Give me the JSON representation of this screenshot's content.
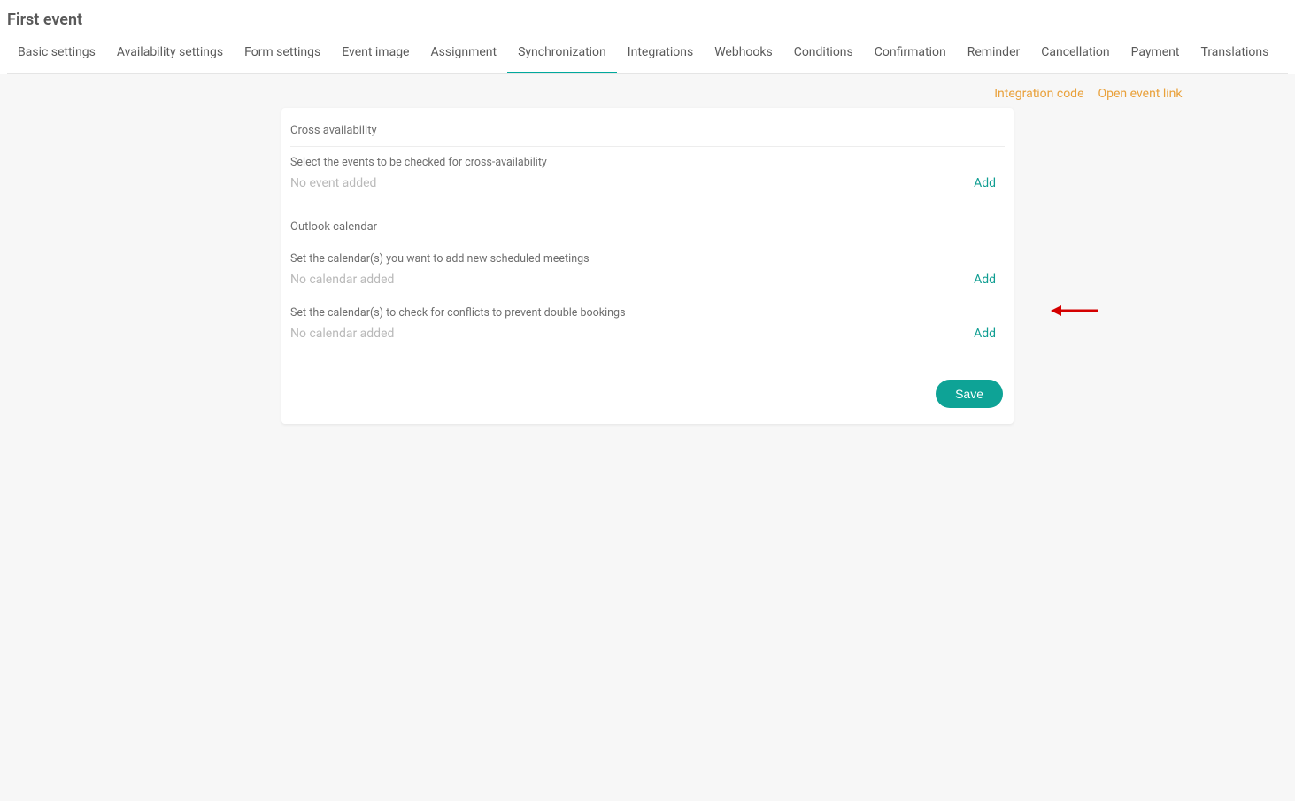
{
  "page_title": "First event",
  "tabs": [
    "Basic settings",
    "Availability settings",
    "Form settings",
    "Event image",
    "Assignment",
    "Synchronization",
    "Integrations",
    "Webhooks",
    "Conditions",
    "Confirmation",
    "Reminder",
    "Cancellation",
    "Payment",
    "Translations"
  ],
  "active_tab_index": 5,
  "top_links": {
    "integration_code": "Integration code",
    "open_event_link": "Open event link"
  },
  "cross_availability": {
    "title": "Cross availability",
    "subtext": "Select the events to be checked for cross-availability",
    "placeholder": "No event added",
    "add_label": "Add"
  },
  "outlook": {
    "title": "Outlook calendar",
    "add_meetings": {
      "subtext": "Set the calendar(s) you want to add new scheduled meetings",
      "placeholder": "No calendar added",
      "add_label": "Add"
    },
    "check_conflicts": {
      "subtext": "Set the calendar(s) to check for conflicts to prevent double bookings",
      "placeholder": "No calendar added",
      "add_label": "Add"
    }
  },
  "save_label": "Save"
}
